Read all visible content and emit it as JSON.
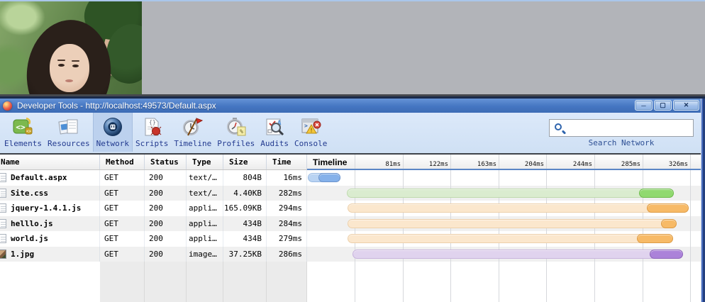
{
  "browser": {
    "photo": {
      "description": "woman with dark hair standing under green leaves"
    }
  },
  "window": {
    "title": "Developer Tools - http://localhost:49573/Default.aspx",
    "controls": [
      {
        "name": "minimize",
        "glyph": "─"
      },
      {
        "name": "restore",
        "glyph": "▢"
      },
      {
        "name": "close",
        "glyph": "✕"
      }
    ]
  },
  "toolbar": {
    "tabs": [
      {
        "label": "Elements",
        "icon": "elements-icon"
      },
      {
        "label": "Resources",
        "icon": "resources-icon"
      },
      {
        "label": "Network",
        "icon": "network-icon"
      },
      {
        "label": "Scripts",
        "icon": "scripts-icon"
      },
      {
        "label": "Timeline",
        "icon": "timeline-icon"
      },
      {
        "label": "Profiles",
        "icon": "profiles-icon"
      },
      {
        "label": "Audits",
        "icon": "audits-icon"
      },
      {
        "label": "Console",
        "icon": "console-icon"
      }
    ],
    "selected_tab": "Network",
    "search": {
      "label": "Search Network",
      "value": "",
      "icon": "search-icon"
    }
  },
  "network_table": {
    "columns": [
      "Name",
      "Method",
      "Status",
      "Type",
      "Size",
      "Time",
      "Timeline"
    ],
    "time_ticks": [
      "81ms",
      "122ms",
      "163ms",
      "204ms",
      "244ms",
      "285ms",
      "326ms"
    ],
    "rows": [
      {
        "name": "Default.aspx",
        "method": "GET",
        "status": "200",
        "type": "text/…",
        "size": "804B",
        "time": "16ms",
        "icon": "document-icon",
        "bar": {
          "color": "blue",
          "light": [
            1,
            47
          ],
          "dark": [
            16,
            47
          ]
        }
      },
      {
        "name": "Site.css",
        "method": "GET",
        "status": "200",
        "type": "text/…",
        "size": "4.40KB",
        "time": "282ms",
        "icon": "document-icon",
        "bar": {
          "color": "green",
          "light": [
            56,
            517
          ],
          "dark": [
            468,
            517
          ]
        }
      },
      {
        "name": "jquery-1.4.1.js",
        "method": "GET",
        "status": "200",
        "type": "appli…",
        "size": "165.09KB",
        "time": "294ms",
        "icon": "document-icon",
        "bar": {
          "color": "orange",
          "light": [
            57,
            538
          ],
          "dark": [
            479,
            538
          ]
        }
      },
      {
        "name": "helllo.js",
        "method": "GET",
        "status": "200",
        "type": "appli…",
        "size": "434B",
        "time": "284ms",
        "icon": "document-icon",
        "bar": {
          "color": "orange",
          "light": [
            57,
            521
          ],
          "dark": [
            499,
            521
          ]
        }
      },
      {
        "name": "world.js",
        "method": "GET",
        "status": "200",
        "type": "appli…",
        "size": "434B",
        "time": "279ms",
        "icon": "document-icon",
        "bar": {
          "color": "orange",
          "light": [
            57,
            516
          ],
          "dark": [
            465,
            516
          ]
        }
      },
      {
        "name": "1.jpg",
        "method": "GET",
        "status": "200",
        "type": "image…",
        "size": "37.25KB",
        "time": "286ms",
        "icon": "image-icon",
        "bar": {
          "color": "purple",
          "light": [
            64,
            530
          ],
          "dark": [
            483,
            530
          ]
        }
      }
    ],
    "bar_colors": {
      "blue": {
        "light": "#b9d3f2",
        "light_border": "#98b9e2",
        "dark": "#85b1ea",
        "dark_border": "#6b93cc"
      },
      "green": {
        "light": "#daeccf",
        "light_border": "#bfdaae",
        "dark": "#90d96f",
        "dark_border": "#6fbb4e"
      },
      "orange": {
        "light": "#fbe7cd",
        "light_border": "#edd0ab",
        "dark": "#f7ba67",
        "dark_border": "#de9c45"
      },
      "purple": {
        "light": "#e0d3ee",
        "light_border": "#c7b3dc",
        "dark": "#ab82d9",
        "dark_border": "#8d64ba"
      }
    }
  }
}
